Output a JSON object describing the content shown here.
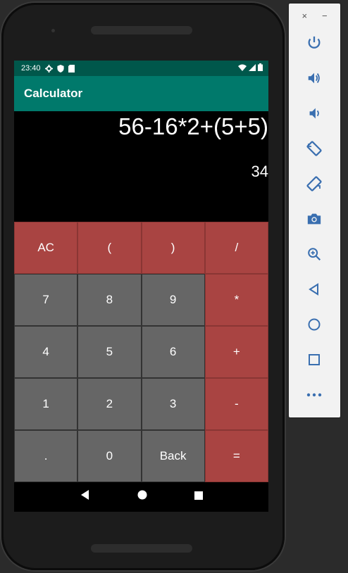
{
  "colors": {
    "status_bar": "#00574b",
    "app_bar": "#00796b",
    "operator_key": "#a94442",
    "number_key": "#666666",
    "display_bg": "#000000",
    "emulator_icon": "#3a6fb0"
  },
  "status_bar": {
    "time": "23:40",
    "icons": [
      "gear-icon",
      "shield-icon",
      "sd-card-icon"
    ],
    "right_icons": [
      "wifi-icon",
      "signal-icon",
      "battery-icon"
    ]
  },
  "app_bar": {
    "title": "Calculator"
  },
  "display": {
    "expression": "56-16*2+(5+5)",
    "result": "34"
  },
  "keys": [
    {
      "label": "AC",
      "style": "red"
    },
    {
      "label": "(",
      "style": "red"
    },
    {
      "label": ")",
      "style": "red"
    },
    {
      "label": "/",
      "style": "red"
    },
    {
      "label": "7",
      "style": "gray"
    },
    {
      "label": "8",
      "style": "gray"
    },
    {
      "label": "9",
      "style": "gray"
    },
    {
      "label": "*",
      "style": "red"
    },
    {
      "label": "4",
      "style": "gray"
    },
    {
      "label": "5",
      "style": "gray"
    },
    {
      "label": "6",
      "style": "gray"
    },
    {
      "label": "+",
      "style": "red"
    },
    {
      "label": "1",
      "style": "gray"
    },
    {
      "label": "2",
      "style": "gray"
    },
    {
      "label": "3",
      "style": "gray"
    },
    {
      "label": "-",
      "style": "red"
    },
    {
      "label": ".",
      "style": "gray"
    },
    {
      "label": "0",
      "style": "gray"
    },
    {
      "label": "Back",
      "style": "gray"
    },
    {
      "label": "=",
      "style": "red"
    }
  ],
  "nav_bar": {
    "icons": [
      "back-triangle-icon",
      "home-circle-icon",
      "recents-square-icon"
    ]
  },
  "emulator_toolbar": {
    "window_controls": {
      "close": "×",
      "minimize": "−"
    },
    "buttons": [
      "power-icon",
      "volume-up-icon",
      "volume-down-icon",
      "rotate-left-icon",
      "rotate-right-icon",
      "camera-icon",
      "zoom-icon",
      "back-icon",
      "home-icon",
      "overview-icon",
      "more-icon"
    ]
  }
}
